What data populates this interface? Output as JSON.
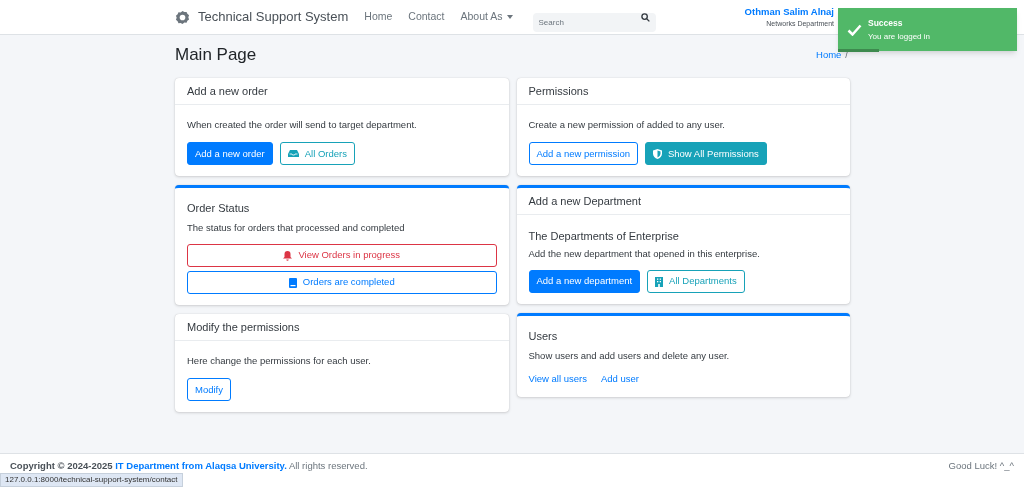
{
  "navbar": {
    "brand": "Technical Support System",
    "links": [
      {
        "label": "Home",
        "kind": "link"
      },
      {
        "label": "Contact",
        "kind": "link"
      },
      {
        "label": "About As",
        "kind": "dropdown"
      }
    ],
    "search": {
      "placeholder": "Search"
    },
    "user_name": "Othman Salim Alnaj",
    "user_department": "Networks Department"
  },
  "toast": {
    "title": "Success",
    "message": "You are logged in",
    "level": 0.23
  },
  "page_title": "Main Page",
  "breadcrumb": {
    "items": [
      "Home"
    ],
    "separator": "/"
  },
  "columns": [
    [
      {
        "title": "Add a new order",
        "header": true,
        "outline": false,
        "text": "When created the order will send to target department.",
        "buttons": [
          {
            "label": "Add a new order",
            "kind": "solid",
            "color": "#007bff"
          },
          {
            "label": "All Orders",
            "kind": "outline",
            "color": "#17a2b8"
          }
        ]
      },
      {
        "title": "Order Status",
        "header": false,
        "outline": true,
        "text": "The status for orders that processed and completed",
        "block": true,
        "buttons": [
          {
            "label": "View Orders in progress",
            "kind": "outline",
            "color": "#dc3545"
          },
          {
            "label": "Orders are completed",
            "kind": "outline",
            "color": "#007bff"
          }
        ]
      },
      {
        "title": "Modify the permissions",
        "header": true,
        "outline": false,
        "text": "Here change the permissions for each user.",
        "buttons": [
          {
            "label": "Modify",
            "kind": "outline",
            "color": "#007bff"
          }
        ]
      }
    ],
    [
      {
        "title": "Permissions",
        "header": true,
        "outline": false,
        "text": "Create a new permission of added to any user.",
        "buttons": [
          {
            "label": "Add a new permission",
            "kind": "outline",
            "color": "#007bff"
          },
          {
            "label": "Show All Permissions",
            "kind": "solid",
            "color": "#17a2b8"
          }
        ]
      },
      {
        "title": "Add a new Department",
        "header": true,
        "outline": true,
        "subtitle": "The Departments of Enterprise",
        "text": "Add the new department that opened in this enterprise.",
        "buttons": [
          {
            "label": "Add a new department",
            "kind": "solid",
            "color": "#007bff"
          },
          {
            "label": "All Departments",
            "kind": "outline",
            "color": "#17a2b8"
          }
        ]
      },
      {
        "title": "Users",
        "header": false,
        "outline": true,
        "text": "Show users and add users and delete any user.",
        "buttons": [
          {
            "label": "View all users",
            "kind": "link"
          },
          {
            "label": "Add user",
            "kind": "link"
          }
        ]
      }
    ]
  ],
  "footer": {
    "before": "Copyright © 2024-2025 ",
    "link": "IT Department from Alaqsa University.",
    "after": " All rights reserved.",
    "right": "Good Luck! ^_^"
  },
  "status_url": "127.0.0.1:8000/technical-support-system/contact"
}
